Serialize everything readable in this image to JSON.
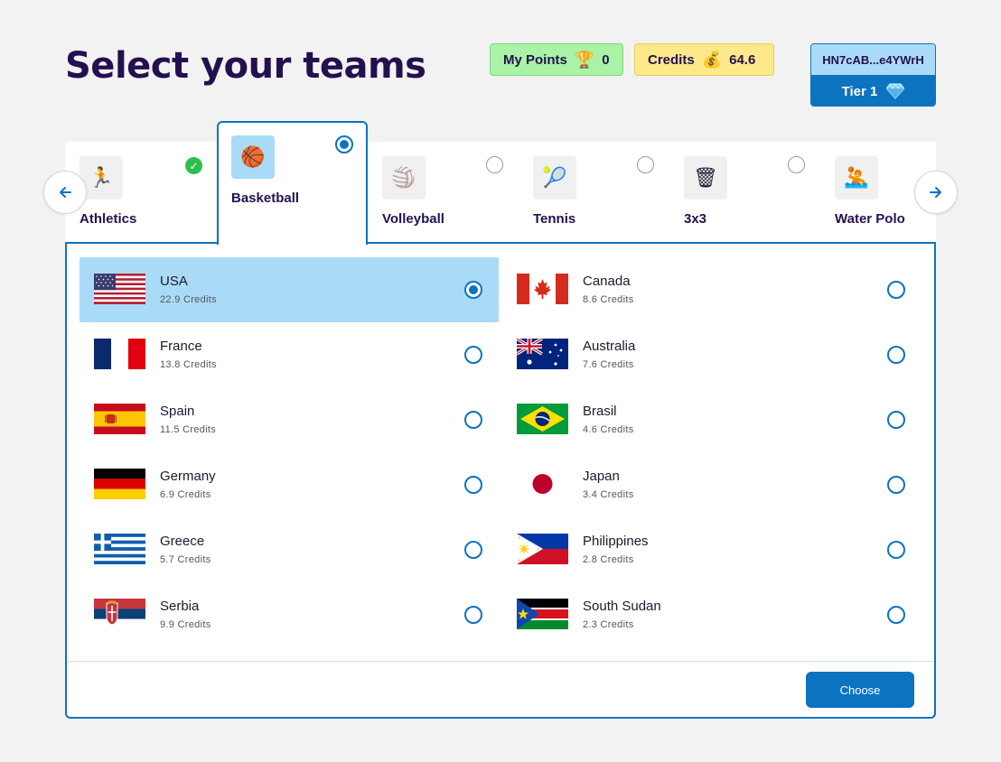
{
  "header": {
    "title": "Select your teams",
    "points_label": "My Points",
    "points_value": "0",
    "credits_label": "Credits",
    "credits_value": "64.6",
    "wallet_address": "HN7cAB...e4YWrH",
    "tier_label": "Tier 1"
  },
  "sports": [
    {
      "label": "Athletics",
      "icon": "🏃",
      "state": "completed"
    },
    {
      "label": "Basketball",
      "icon": "🏀",
      "state": "selected"
    },
    {
      "label": "Volleyball",
      "icon": "🏐",
      "state": "unselected"
    },
    {
      "label": "Tennis",
      "icon": "🎾",
      "state": "unselected"
    },
    {
      "label": "3x3",
      "icon": "🗑",
      "state": "unselected"
    },
    {
      "label": "Water Polo",
      "icon": "🤽",
      "state": "unselected"
    }
  ],
  "teams": [
    {
      "name": "USA",
      "credits": "22.9 Credits",
      "flag": "usa",
      "selected": true
    },
    {
      "name": "Canada",
      "credits": "8.6 Credits",
      "flag": "canada",
      "selected": false
    },
    {
      "name": "France",
      "credits": "13.8 Credits",
      "flag": "france",
      "selected": false
    },
    {
      "name": "Australia",
      "credits": "7.6 Credits",
      "flag": "australia",
      "selected": false
    },
    {
      "name": "Spain",
      "credits": "11.5 Credits",
      "flag": "spain",
      "selected": false
    },
    {
      "name": "Brasil",
      "credits": "4.6 Credits",
      "flag": "brazil",
      "selected": false
    },
    {
      "name": "Germany",
      "credits": "6.9 Credits",
      "flag": "germany",
      "selected": false
    },
    {
      "name": "Japan",
      "credits": "3.4 Credits",
      "flag": "japan",
      "selected": false
    },
    {
      "name": "Greece",
      "credits": "5.7 Credits",
      "flag": "greece",
      "selected": false
    },
    {
      "name": "Philippines",
      "credits": "2.8 Credits",
      "flag": "philippines",
      "selected": false
    },
    {
      "name": "Serbia",
      "credits": "9.9 Credits",
      "flag": "serbia",
      "selected": false
    },
    {
      "name": "South Sudan",
      "credits": "2.3 Credits",
      "flag": "south-sudan",
      "selected": false
    }
  ],
  "actions": {
    "choose_label": "Choose"
  },
  "icons": {
    "points": "trophy-icon",
    "credits": "money-bag-icon",
    "tier": "diamond-icon",
    "prev": "arrow-left-icon",
    "next": "arrow-right-icon"
  },
  "colors": {
    "accent": "#0b73c0",
    "selected_bg": "#a9dbf8",
    "points_bg": "#a9f2a6",
    "credits_bg": "#fde98a",
    "title": "#24104f",
    "check": "#2fbf4d"
  }
}
